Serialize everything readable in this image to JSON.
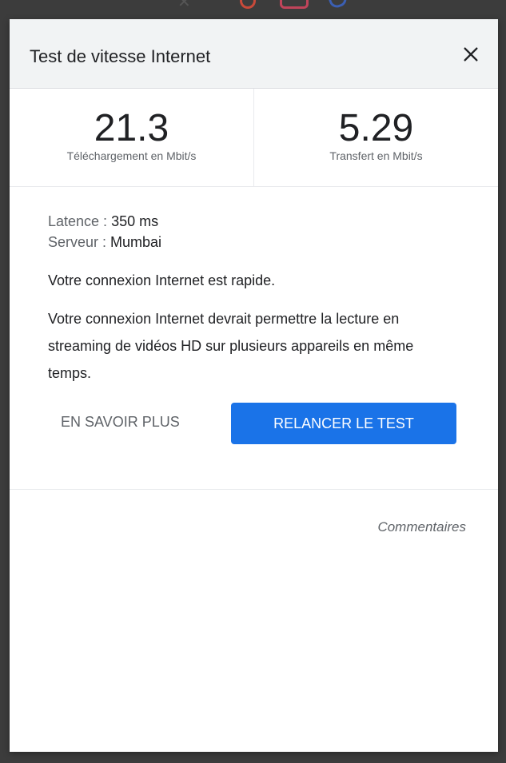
{
  "dialog": {
    "title": "Test de vitesse Internet",
    "close_icon": "close-icon"
  },
  "metrics": {
    "download": {
      "value": "21.3",
      "label": "Téléchargement en Mbit/s"
    },
    "upload": {
      "value": "5.29",
      "label": "Transfert en Mbit/s"
    }
  },
  "details": {
    "latency_label": "Latence : ",
    "latency_value": "350 ms",
    "server_label": "Serveur : ",
    "server_value": "Mumbai",
    "speed_message": "Votre connexion Internet est rapide.",
    "capability_message": "Votre connexion Internet devrait permettre la lecture en streaming de vidéos HD sur plusieurs appareils en même temps."
  },
  "actions": {
    "learn_more": "EN SAVOIR PLUS",
    "retest": "RELANCER LE TEST"
  },
  "footer": {
    "feedback": "Commentaires"
  },
  "colors": {
    "accent": "#1a73e8",
    "header_bg": "#f1f3f4"
  }
}
